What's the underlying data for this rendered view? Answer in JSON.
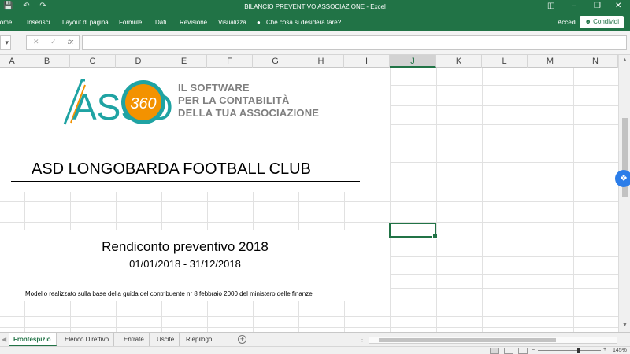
{
  "window": {
    "title": "BILANCIO PREVENTIVO ASSOCIAZIONE - Excel"
  },
  "ribbon": {
    "tabs": [
      "Home",
      "Inserisci",
      "Layout di pagina",
      "Formule",
      "Dati",
      "Revisione",
      "Visualizza"
    ],
    "tell_me": "Che cosa si desidera fare?",
    "signin": "Accedi",
    "share": "Condividi"
  },
  "formula_bar": {
    "fx": "fx",
    "value": ""
  },
  "columns": [
    "A",
    "B",
    "C",
    "D",
    "E",
    "F",
    "G",
    "H",
    "I",
    "J",
    "K",
    "L",
    "M",
    "N"
  ],
  "selected_column": "J",
  "sheet": {
    "logo_text_lines": [
      "IL SOFTWARE",
      "PER LA CONTABILITÀ",
      "DELLA TUA ASSOCIAZIONE"
    ],
    "logo_wordmark": "ASSO",
    "logo_badge": "360",
    "club_name": "ASD LONGOBARDA FOOTBALL CLUB",
    "report_title": "Rendiconto preventivo 2018",
    "period": "01/01/2018 - 31/12/2018",
    "footnote": "Modello realizzato sulla base della guida del contribuente nr 8 febbraio 2000 del ministero delle finanze"
  },
  "sheet_tabs": [
    "Frontespizio",
    "Elenco Direttivo",
    "Entrate",
    "Uscite",
    "Riepilogo"
  ],
  "active_sheet": "Frontespizio",
  "status": {
    "zoom": "145%"
  },
  "colors": {
    "excel_green": "#217346",
    "logo_teal": "#1fa3a3",
    "logo_orange": "#f39200"
  }
}
